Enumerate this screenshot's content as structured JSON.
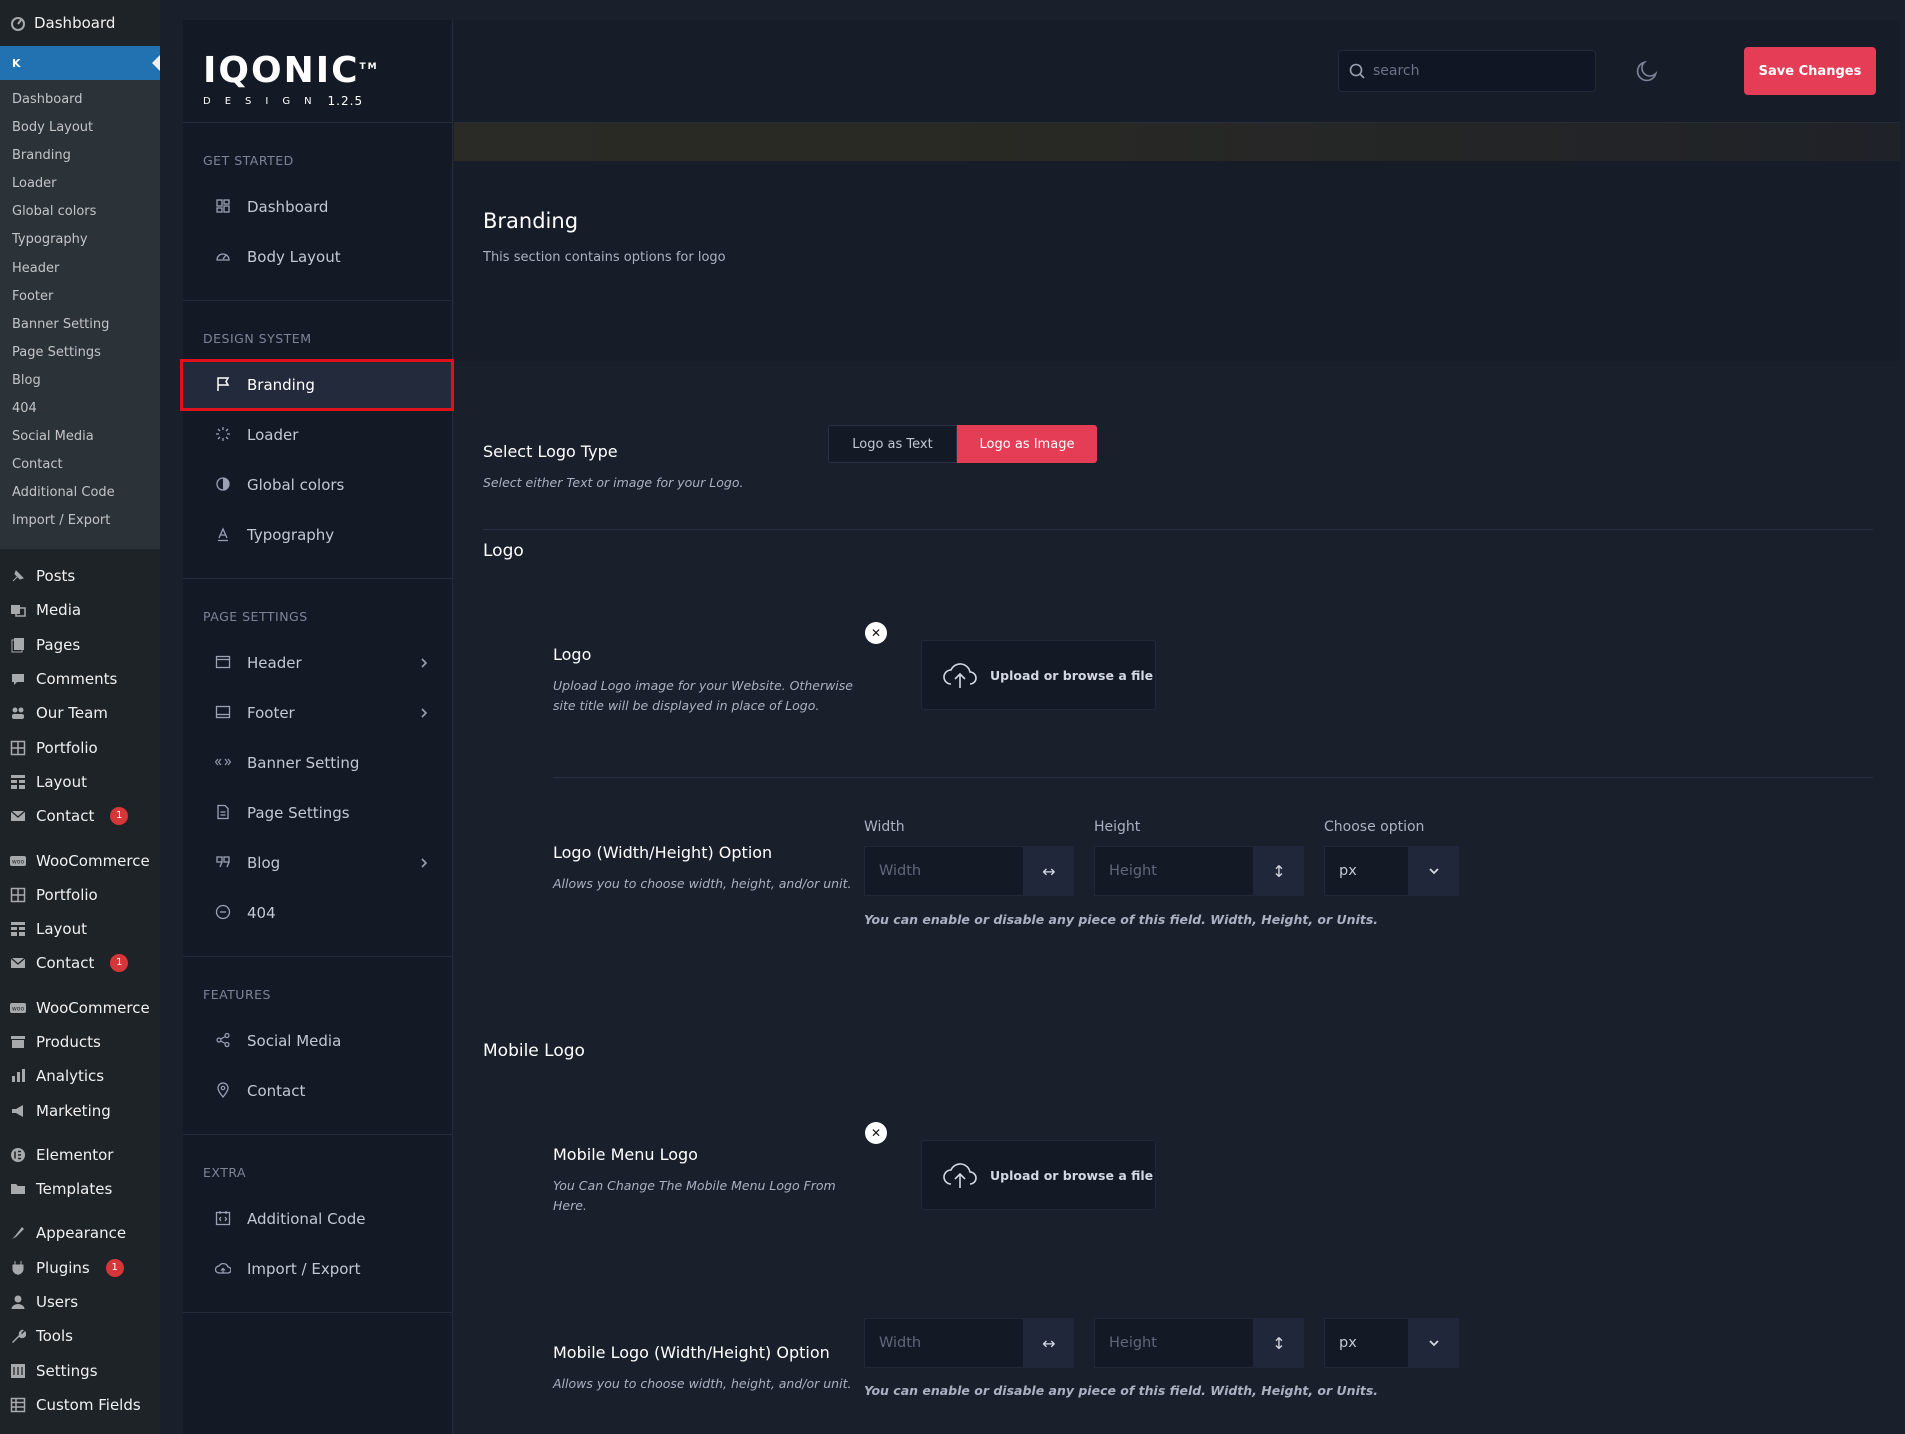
{
  "wp": {
    "top": "Dashboard",
    "active_initial": "K",
    "submenu": [
      "Dashboard",
      "Body Layout",
      "Branding",
      "Loader",
      "Global colors",
      "Typography",
      "Header",
      "Footer",
      "Banner Setting",
      "Page Settings",
      "Blog",
      "404",
      "Social Media",
      "Contact",
      "Additional Code",
      "Import / Export"
    ],
    "menu": [
      {
        "label": "Posts",
        "icon": "pin-icon"
      },
      {
        "label": "Media",
        "icon": "media-icon"
      },
      {
        "label": "Pages",
        "icon": "pages-icon"
      },
      {
        "label": "Comments",
        "icon": "comment-icon"
      },
      {
        "label": "Our Team",
        "icon": "team-icon"
      },
      {
        "label": "Portfolio",
        "icon": "grid-icon"
      },
      {
        "label": "Layout",
        "icon": "layout-icon"
      },
      {
        "label": "Contact",
        "icon": "mail-icon",
        "badge": "1"
      },
      {
        "label": "WooCommerce",
        "icon": "woo-icon",
        "gap": true
      },
      {
        "label": "Portfolio",
        "icon": "grid-icon"
      },
      {
        "label": "Layout",
        "icon": "layout-icon"
      },
      {
        "label": "Contact",
        "icon": "mail-icon",
        "badge": "1"
      },
      {
        "label": "WooCommerce",
        "icon": "woo-icon",
        "gap": true
      },
      {
        "label": "Products",
        "icon": "products-icon"
      },
      {
        "label": "Analytics",
        "icon": "analytics-icon"
      },
      {
        "label": "Marketing",
        "icon": "megaphone-icon"
      },
      {
        "label": "Elementor",
        "icon": "elementor-icon",
        "gap": true
      },
      {
        "label": "Templates",
        "icon": "folder-icon"
      },
      {
        "label": "Appearance",
        "icon": "brush-icon",
        "gap": true
      },
      {
        "label": "Plugins",
        "icon": "plugin-icon",
        "badge": "1"
      },
      {
        "label": "Users",
        "icon": "user-icon"
      },
      {
        "label": "Tools",
        "icon": "wrench-icon"
      },
      {
        "label": "Settings",
        "icon": "settings-icon"
      },
      {
        "label": "Custom Fields",
        "icon": "fields-icon"
      }
    ]
  },
  "brand": {
    "logo_main": "IQONIC",
    "logo_tm": "TM",
    "logo_sub": "DESIGN",
    "version": "1.2.5"
  },
  "nav": {
    "groups": [
      {
        "title": "GET STARTED",
        "items": [
          {
            "label": "Dashboard",
            "icon": "dashboard-icon"
          },
          {
            "label": "Body Layout",
            "icon": "gauge-icon"
          }
        ]
      },
      {
        "title": "DESIGN SYSTEM",
        "items": [
          {
            "label": "Branding",
            "icon": "flag-icon",
            "active": true
          },
          {
            "label": "Loader",
            "icon": "loader-icon"
          },
          {
            "label": "Global colors",
            "icon": "contrast-icon"
          },
          {
            "label": "Typography",
            "icon": "type-icon"
          }
        ]
      },
      {
        "title": "PAGE SETTINGS",
        "items": [
          {
            "label": "Header",
            "icon": "window-icon",
            "chevron": true
          },
          {
            "label": "Footer",
            "icon": "laptop-icon",
            "chevron": true
          },
          {
            "label": "Banner Setting",
            "icon": "code-icon"
          },
          {
            "label": "Page Settings",
            "icon": "page-icon"
          },
          {
            "label": "Blog",
            "icon": "quote-icon",
            "chevron": true
          },
          {
            "label": "404",
            "icon": "minus-circle-icon"
          }
        ]
      },
      {
        "title": "FEATURES",
        "items": [
          {
            "label": "Social Media",
            "icon": "share-icon"
          },
          {
            "label": "Contact",
            "icon": "location-icon"
          }
        ]
      },
      {
        "title": "EXTRA",
        "items": [
          {
            "label": "Additional Code",
            "icon": "code-box-icon"
          },
          {
            "label": "Import / Export",
            "icon": "cloud-icon"
          }
        ]
      }
    ]
  },
  "topbar": {
    "search_placeholder": "search",
    "save_label": "Save Changes"
  },
  "page": {
    "title": "Branding",
    "subtitle": "This section contains options for logo"
  },
  "logo_type": {
    "label": "Select Logo Type",
    "desc": "Select either Text or image for your Logo.",
    "options": [
      "Logo as Text",
      "Logo as Image"
    ],
    "selected": "Logo as Image"
  },
  "logo_section": {
    "title": "Logo",
    "logo_label": "Logo",
    "logo_desc": "Upload Logo image for your Website. Otherwise site title will be displayed in place of Logo.",
    "upload_label": "Upload or browse a file",
    "size_label": "Logo (Width/Height) Option",
    "size_desc": "Allows you to choose width, height, and/or unit.",
    "width_label": "Width",
    "height_label": "Height",
    "unit_label": "Choose option",
    "width_placeholder": "Width",
    "height_placeholder": "Height",
    "unit_value": "px",
    "hint": "You can enable or disable any piece of this field. Width, Height, or Units."
  },
  "mobile_section": {
    "title": "Mobile Logo",
    "logo_label": "Mobile Menu Logo",
    "logo_desc": "You Can Change The Mobile Menu Logo From Here.",
    "upload_label": "Upload or browse a file",
    "size_label": "Mobile Logo (Width/Height) Option",
    "size_desc": "Allows you to choose width, height, and/or unit.",
    "width_placeholder": "Width",
    "height_placeholder": "Height",
    "unit_value": "px",
    "hint": "You can enable or disable any piece of this field. Width, Height, or Units."
  }
}
